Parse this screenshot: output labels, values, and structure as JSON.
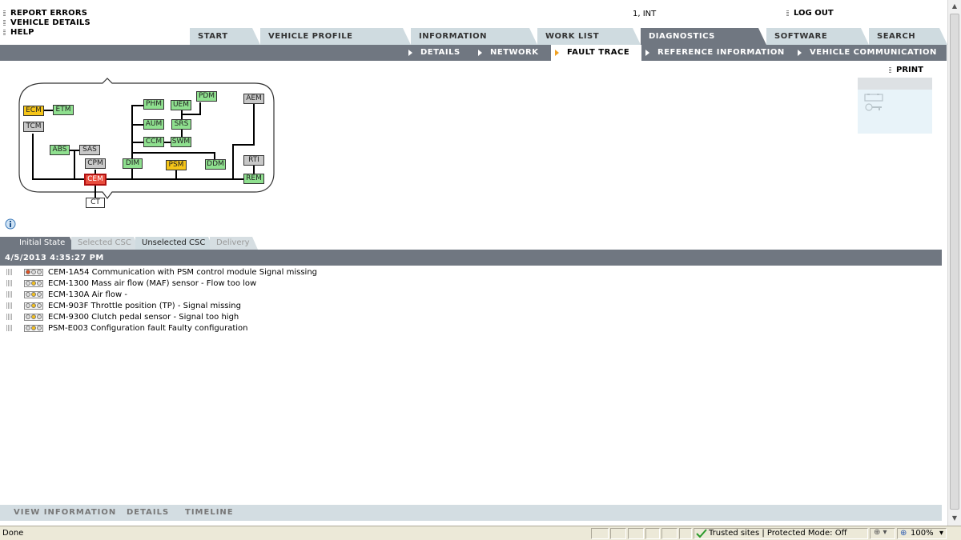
{
  "top_links": [
    "REPORT ERRORS",
    "VEHICLE DETAILS",
    "HELP"
  ],
  "user_info": "1, INT",
  "logout_label": "LOG OUT",
  "tabs": [
    "START",
    "VEHICLE PROFILE",
    "INFORMATION",
    "WORK LIST",
    "DIAGNOSTICS",
    "SOFTWARE",
    "SEARCH"
  ],
  "active_tab": "DIAGNOSTICS",
  "subnav": [
    "DETAILS",
    "NETWORK",
    "FAULT TRACE",
    "REFERENCE INFORMATION",
    "VEHICLE COMMUNICATION"
  ],
  "active_subnav": "FAULT TRACE",
  "print_label": "PRINT",
  "network_nodes": [
    "ECM",
    "ETM",
    "TCM",
    "ABS",
    "SAS",
    "CPM",
    "CEM",
    "CT",
    "PHM",
    "UEM",
    "PDM",
    "AUM",
    "SRS",
    "CCM",
    "SWM",
    "DIM",
    "PSM",
    "DDM",
    "AEM",
    "RTI",
    "REM"
  ],
  "node_status_colors": {
    "ok": "#8fe08f",
    "warning": "#f5c518",
    "no_response": "#c8c8c8",
    "fault": "#e84c3d"
  },
  "result_tabs": [
    "Initial State",
    "Selected CSC",
    "Unselected CSC",
    "Delivery"
  ],
  "timestamp": "4/5/2013 4:35:27 PM",
  "faults": [
    "CEM-1A54 Communication with PSM control module Signal missing",
    "ECM-1300 Mass air flow (MAF) sensor - Flow too low",
    "ECM-130A Air flow -",
    "ECM-903F Throttle position (TP) - Signal missing",
    "ECM-9300 Clutch pedal sensor - Signal too high",
    "PSM-E003 Configuration fault Faulty configuration"
  ],
  "bottom_tabs": [
    "VIEW INFORMATION",
    "DETAILS",
    "TIMELINE"
  ],
  "status": {
    "left": "Done",
    "zone": "Trusted sites | Protected Mode: Off",
    "zoom": "100%"
  }
}
